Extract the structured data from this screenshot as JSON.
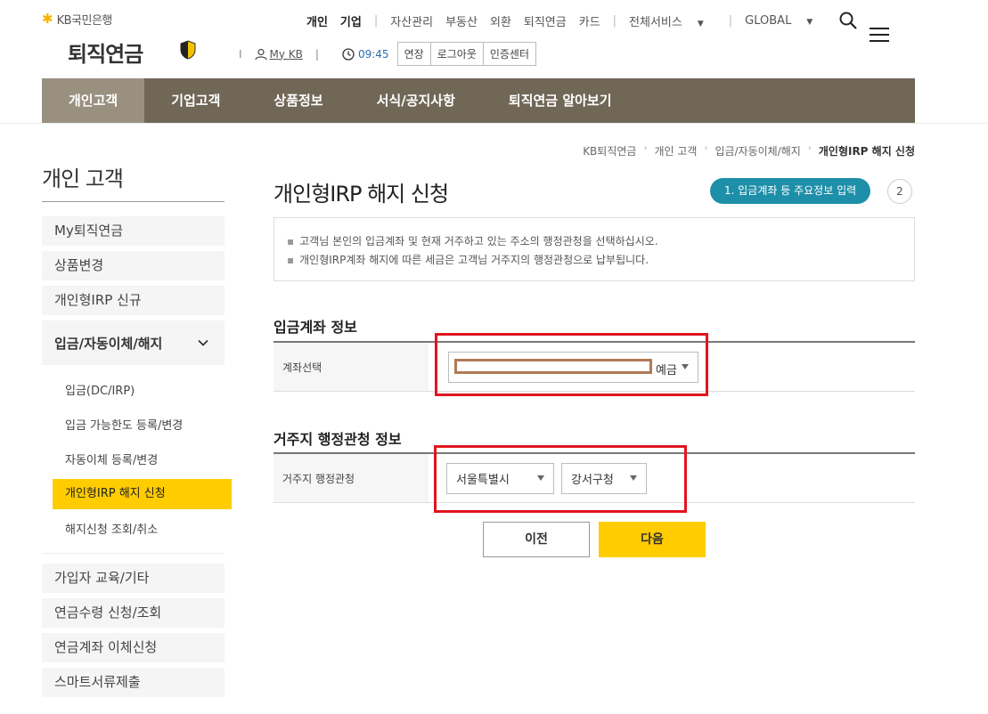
{
  "brand": {
    "bank_name": "KB국민은행",
    "app_title": "퇴직연금",
    "accent": "#ffcc00",
    "nav_bg": "#716757",
    "step_color": "#1e8fa8"
  },
  "topnav": {
    "personal": "개인",
    "corporate": "기업",
    "assets": "자산관리",
    "real_estate": "부동산",
    "forex": "외환",
    "pension": "퇴직연금",
    "card": "카드",
    "all_services": "전체서비스",
    "global": "GLOBAL"
  },
  "userbar": {
    "pipe": "I",
    "mykb": "My KB",
    "time": "09:45",
    "extend": "연장",
    "logout": "로그아웃",
    "cert": "인증센터"
  },
  "mainnav": [
    "개인고객",
    "기업고객",
    "상품정보",
    "서식/공지사항",
    "퇴직연금 알아보기"
  ],
  "breadcrumb": [
    "KB퇴직연금",
    "개인 고객",
    "입금/자동이체/해지",
    "개인형IRP 해지 신청"
  ],
  "sidebar": {
    "title": "개인 고객",
    "items_top": [
      "My퇴직연금",
      "상품변경",
      "개인형IRP 신규"
    ],
    "group_label": "입금/자동이체/해지",
    "sub_items": [
      "입금(DC/IRP)",
      "입금 가능한도 등록/변경",
      "자동이체 등록/변경",
      "개인형IRP 해지 신청",
      "해지신청 조회/취소"
    ],
    "items_bottom": [
      "가입자 교육/기타",
      "연금수령 신청/조회",
      "연금계좌 이체신청",
      "스마트서류제출"
    ]
  },
  "page": {
    "title": "개인형IRP 해지 신청",
    "step1": "1. 입금계좌 등 주요정보 입력",
    "step2": "2",
    "notices": [
      "고객님 본인의 입금계좌 및 현재 거주하고 있는 주소의 행정관청을 선택하십시오.",
      "개인형IRP계좌 해지에 따른 세금은 고객님 거주지의 행정관청으로 납부됩니다."
    ]
  },
  "section_account": {
    "title": "입금계좌 정보",
    "label": "계좌선택",
    "selected_suffix": "예금"
  },
  "section_address": {
    "title": "거주지 행정관청 정보",
    "label": "거주지 행정관청",
    "city": "서울특별시",
    "district": "강서구청"
  },
  "buttons": {
    "prev": "이전",
    "next": "다음"
  }
}
